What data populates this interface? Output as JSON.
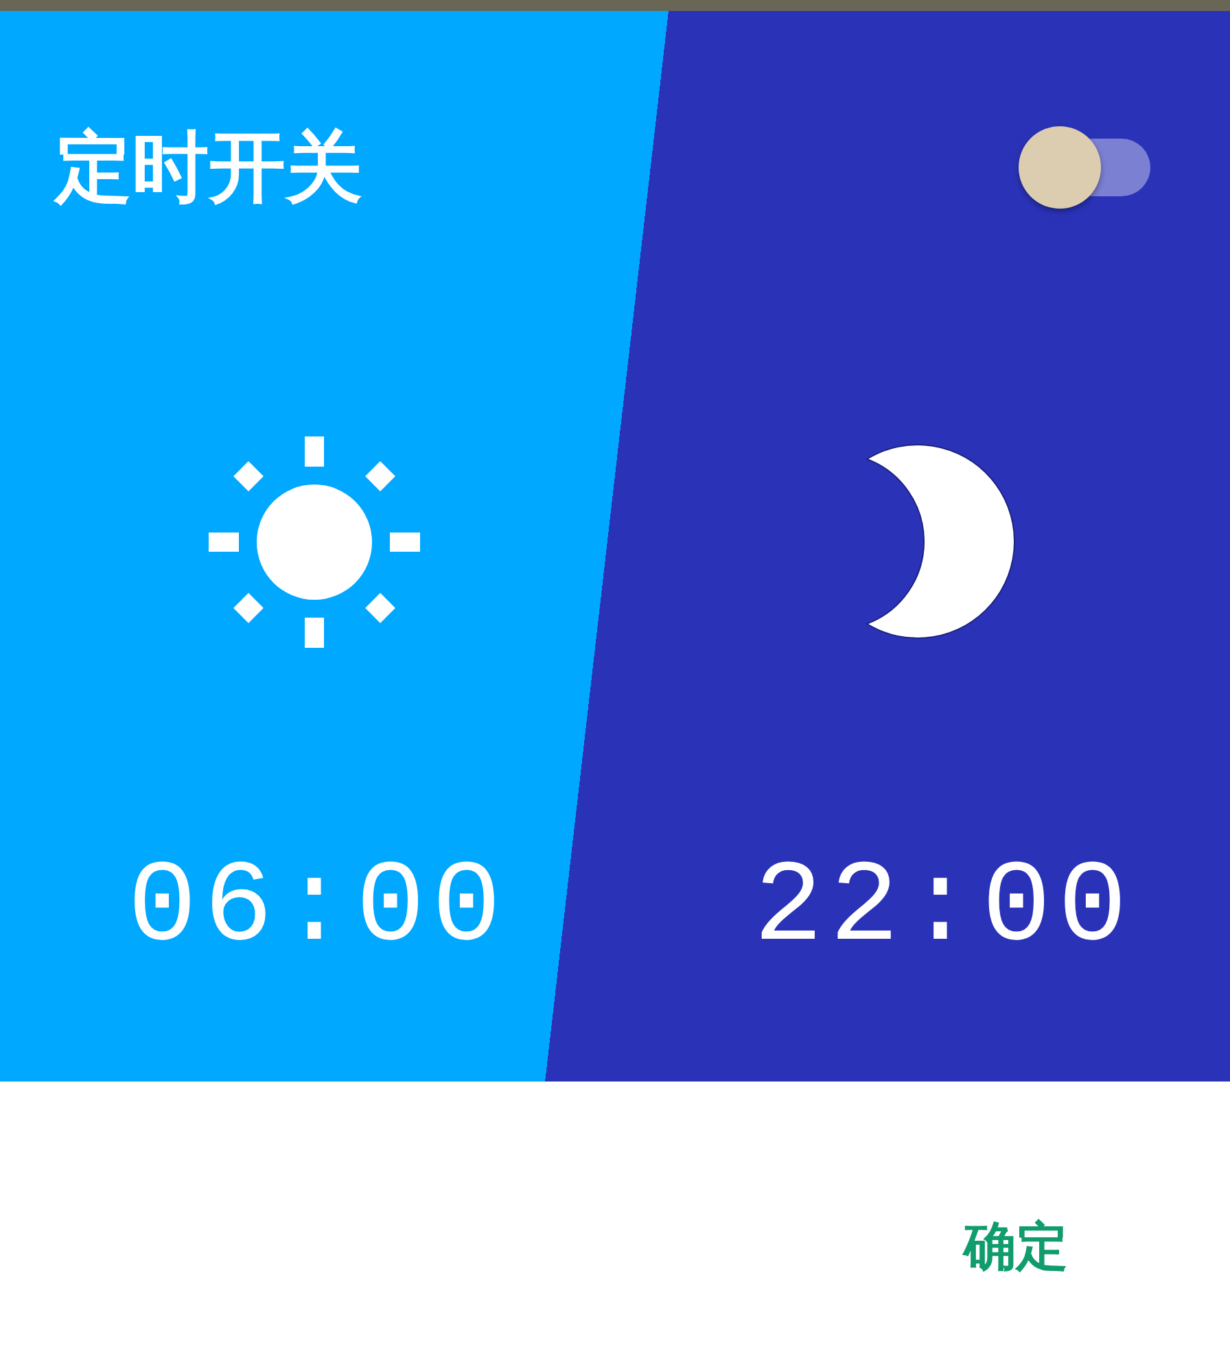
{
  "dialog": {
    "title": "定时开关",
    "switch": {
      "on": false
    },
    "periods": [
      {
        "kind": "day",
        "time": "06:00"
      },
      {
        "kind": "night",
        "time": "22:00"
      }
    ],
    "buttons": [
      {
        "label": "确定"
      }
    ]
  }
}
